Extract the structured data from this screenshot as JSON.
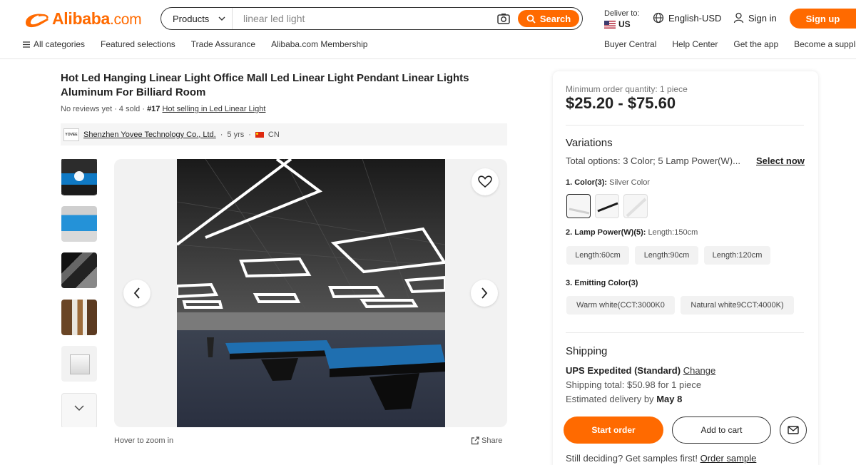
{
  "header": {
    "logo_text": "Alibaba",
    "logo_suffix": ".com",
    "search": {
      "category": "Products",
      "value": "linear led light",
      "button_label": "Search"
    },
    "deliver": {
      "label": "Deliver to:",
      "country": "US"
    },
    "language": "English-USD",
    "signin": "Sign in",
    "signup": "Sign up",
    "nav_left": [
      "All categories",
      "Featured selections",
      "Trade Assurance",
      "Alibaba.com Membership"
    ],
    "nav_right": [
      "Buyer Central",
      "Help Center",
      "Get the app",
      "Become a supplier"
    ]
  },
  "product": {
    "title": "Hot Led Hanging Linear Light Office Mall Led Linear Light Pendant Linear Lights Aluminum For Billiard Room",
    "reviews": "No reviews yet",
    "sold": "4 sold",
    "rank": "#17",
    "rank_link": "Hot selling in Led Linear Light",
    "supplier": {
      "logo_text": "YOVEE",
      "name": "Shenzhen Yovee Technology Co., Ltd.",
      "years": "5 yrs",
      "country": "CN"
    },
    "hover_hint": "Hover to zoom in",
    "share": "Share"
  },
  "order": {
    "moq": "Minimum order quantity: 1 piece",
    "price": "$25.20 - $75.60",
    "variations_title": "Variations",
    "total_options": "Total options: 3 Color; 5 Lamp Power(W)...",
    "select_now": "Select now",
    "color_label": "1. Color(3):",
    "color_selected": "Silver Color",
    "power_label": "2. Lamp Power(W)(5):",
    "power_selected": "Length:150cm",
    "power_options": [
      "Length:60cm",
      "Length:90cm",
      "Length:120cm"
    ],
    "emit_label": "3. Emitting Color(3)",
    "emit_options": [
      "Warm white(CCT:3000K0",
      "Natural white9CCT:4000K)"
    ],
    "shipping_title": "Shipping",
    "ship_method": "UPS Expedited (Standard)",
    "ship_change": "Change",
    "ship_total": "Shipping total: $50.98 for 1 piece",
    "delivery_prefix": "Estimated delivery by",
    "delivery_date": "May 8",
    "start_order": "Start order",
    "add_to_cart": "Add to cart",
    "samples_prefix": "Still deciding? Get samples first!",
    "samples_link": "Order sample"
  },
  "colors": {
    "accent": "#ff6a00"
  }
}
